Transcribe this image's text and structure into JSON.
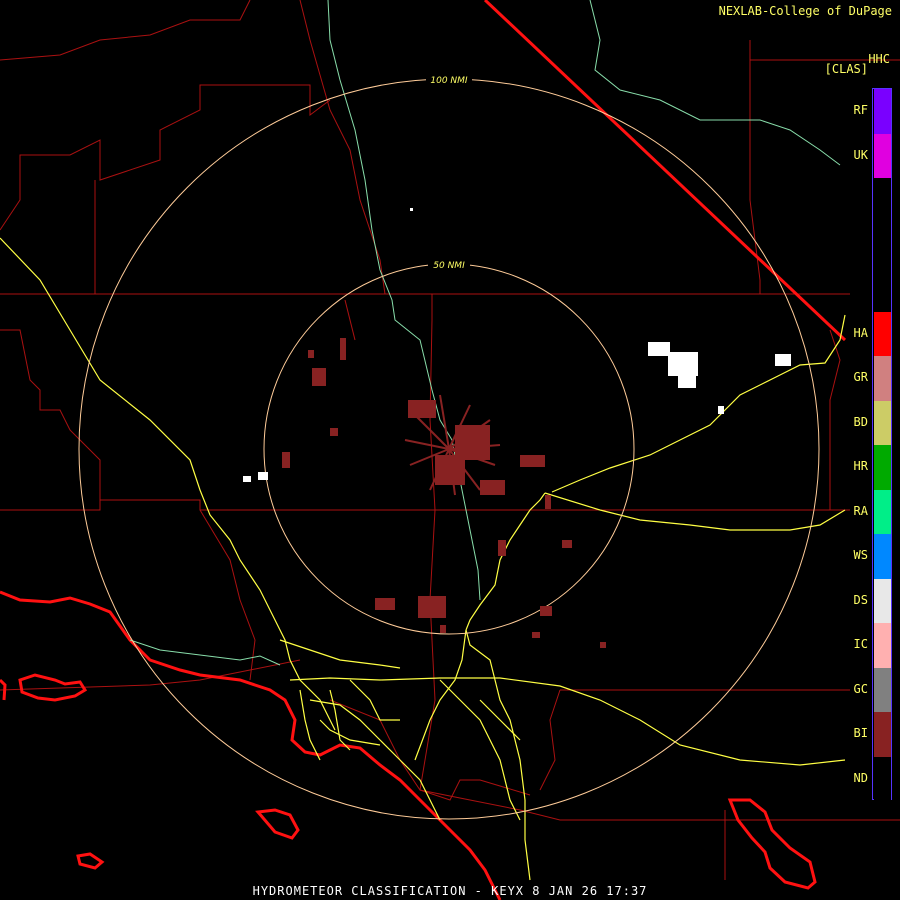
{
  "header": {
    "credit": "NEXLAB-College of DuPage",
    "product_code": "HHC",
    "product_tag": "[CLAS]"
  },
  "footer": {
    "title": "HYDROMETEOR CLASSIFICATION - KEYX 8 JAN 26 17:37"
  },
  "range_rings": [
    {
      "label": "50 NMI"
    },
    {
      "label": "100 NMI"
    }
  ],
  "legend": [
    {
      "code": "RF",
      "color": "#7a00ff"
    },
    {
      "code": "UK",
      "color": "#e000e0"
    },
    {
      "code": "",
      "color": "#000000"
    },
    {
      "code": "",
      "color": "#000000"
    },
    {
      "code": "",
      "color": "#000000"
    },
    {
      "code": "HA",
      "color": "#ff0000"
    },
    {
      "code": "GR",
      "color": "#d08080"
    },
    {
      "code": "BD",
      "color": "#cccc66"
    },
    {
      "code": "HR",
      "color": "#00aa00"
    },
    {
      "code": "RA",
      "color": "#00ee88"
    },
    {
      "code": "WS",
      "color": "#0088ff"
    },
    {
      "code": "DS",
      "color": "#e8e8e8"
    },
    {
      "code": "IC",
      "color": "#ffb0b0"
    },
    {
      "code": "GC",
      "color": "#808080"
    },
    {
      "code": "BI",
      "color": "#882222"
    },
    {
      "code": "ND",
      "color": "#000000"
    }
  ],
  "map_colors": {
    "county_lines": "#aa1111",
    "state_line": "#ff1111",
    "coastline": "#ff1111",
    "rivers": "#88ddaa",
    "highways": "#ffff44",
    "range_rings": "#ffcc99"
  }
}
